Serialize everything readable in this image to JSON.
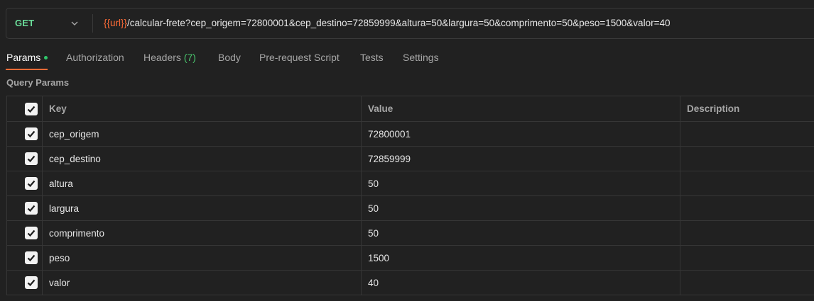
{
  "request": {
    "method": "GET",
    "url_variable": "{{url}}",
    "url_path": "/calcular-frete?cep_origem=72800001&cep_destino=72859999&altura=50&largura=50&comprimento=50&peso=1500&valor=40"
  },
  "tabs": [
    {
      "label": "Params",
      "active": true,
      "dot": true
    },
    {
      "label": "Authorization"
    },
    {
      "label": "Headers",
      "count": "(7)"
    },
    {
      "label": "Body"
    },
    {
      "label": "Pre-request Script"
    },
    {
      "label": "Tests"
    },
    {
      "label": "Settings"
    }
  ],
  "query_params": {
    "title": "Query Params",
    "headers": {
      "key": "Key",
      "value": "Value",
      "description": "Description"
    },
    "rows": [
      {
        "key": "cep_origem",
        "value": "72800001",
        "description": "",
        "checked": true
      },
      {
        "key": "cep_destino",
        "value": "72859999",
        "description": "",
        "checked": true
      },
      {
        "key": "altura",
        "value": "50",
        "description": "",
        "checked": true
      },
      {
        "key": "largura",
        "value": "50",
        "description": "",
        "checked": true
      },
      {
        "key": "comprimento",
        "value": "50",
        "description": "",
        "checked": true
      },
      {
        "key": "peso",
        "value": "1500",
        "description": "",
        "checked": true
      },
      {
        "key": "valor",
        "value": "40",
        "description": "",
        "checked": true
      }
    ]
  },
  "colors": {
    "background": "#212121",
    "method_get": "#6bdd9a",
    "url_variable": "#ff6c37",
    "active_tab_underline": "#ff6c37",
    "params_dot": "#2fc76a",
    "headers_count": "#49c46c"
  }
}
